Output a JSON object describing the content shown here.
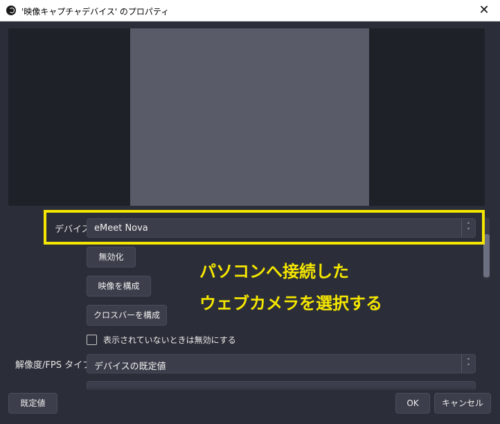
{
  "window": {
    "title": "'映像キャプチャデバイス' のプロパティ",
    "close_glyph": "✕"
  },
  "properties": {
    "device": {
      "label": "デバイス",
      "value": "eMeet Nova"
    },
    "deactivate_button": "無効化",
    "configure_video_button": "映像を構成",
    "configure_crossbar_button": "クロスバーを構成",
    "deactivate_when_hidden": {
      "label": "表示されていないときは無効にする",
      "checked": false
    },
    "resolution_fps_type": {
      "label": "解像度/FPS タイプ",
      "value": "デバイスの既定値"
    }
  },
  "annotation": {
    "line1": "パソコンへ接続した",
    "line2": "ウェブカメラを選択する",
    "color": "#f5e600"
  },
  "footer": {
    "defaults_button": "既定値",
    "ok_button": "OK",
    "cancel_button": "キャンセル"
  },
  "icons": {
    "select_arrow": "⌃⌄"
  },
  "colors": {
    "background": "#2b2e38",
    "preview": "#595b69",
    "highlight": "#f5e600"
  }
}
